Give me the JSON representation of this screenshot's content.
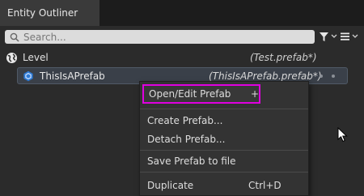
{
  "window": {
    "tab_title": "Entity Outliner"
  },
  "search": {
    "placeholder": "Search..."
  },
  "tree": {
    "level": {
      "name": "Level",
      "file": "(Test.prefab*)"
    },
    "prefab": {
      "name": "ThisIsAPrefab",
      "file": "(ThisIsAPrefab.prefab*)"
    }
  },
  "context_menu": {
    "open_edit": "Open/Edit Prefab",
    "open_edit_suffix": "+",
    "create": "Create Prefab...",
    "detach": "Detach Prefab...",
    "save": "Save Prefab to file",
    "duplicate": "Duplicate",
    "duplicate_shortcut": "Ctrl+D"
  },
  "colors": {
    "highlight": "#e000e0",
    "prefab_icon": "#2e7bd6"
  },
  "icons": [
    "search-icon",
    "filter-icon",
    "chevron-down-icon",
    "menu-icon",
    "globe-icon",
    "prefab-icon",
    "cursor-icon"
  ]
}
